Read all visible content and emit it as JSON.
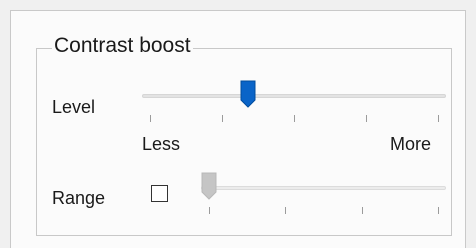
{
  "group": {
    "title": "Contrast boost"
  },
  "level": {
    "label": "Level",
    "min_label": "Less",
    "max_label": "More",
    "value_fraction": 0.34,
    "tick_count": 5,
    "thumb_color": "#0a64c8"
  },
  "range": {
    "label": "Range",
    "checked": false,
    "enabled": false,
    "value_fraction": 0.0,
    "tick_count": 4,
    "thumb_color": "#c5c5c5"
  }
}
